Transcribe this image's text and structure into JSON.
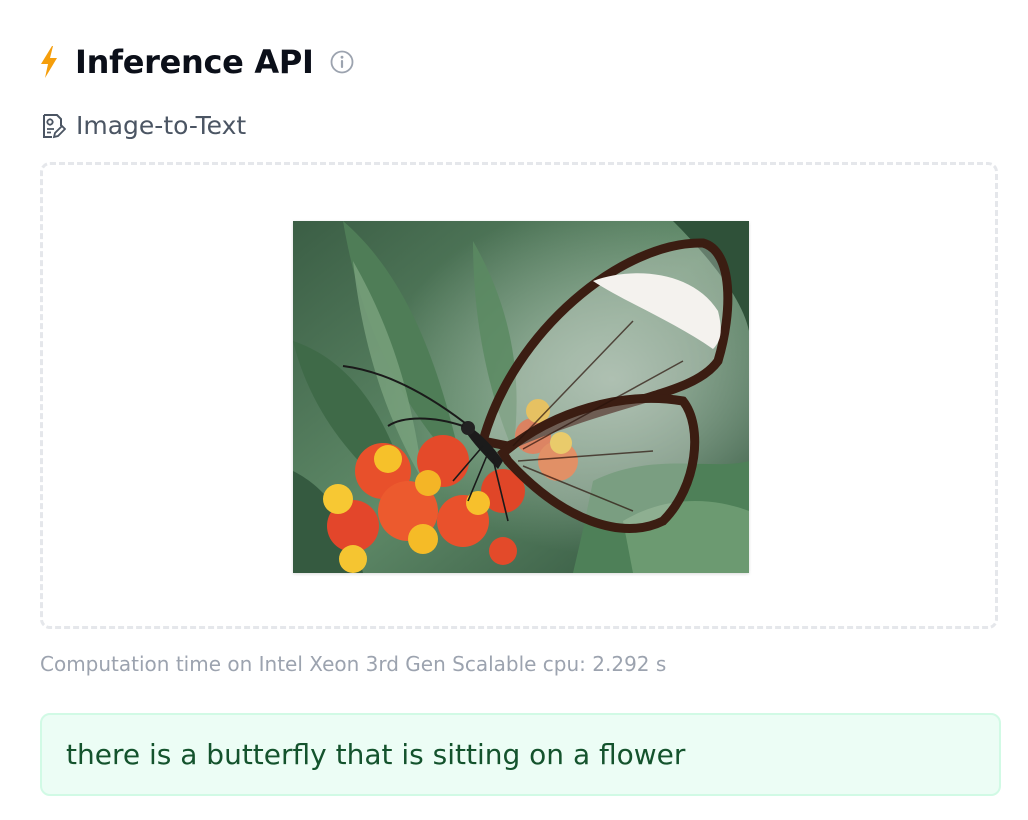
{
  "header": {
    "title": "Inference API",
    "bolt_icon": "lightning-bolt-icon",
    "info_icon": "info-icon",
    "accent_color": "#f59e0b"
  },
  "task": {
    "icon": "image-to-text-task-icon",
    "label": "Image-to-Text"
  },
  "dropzone": {
    "image_subject": "butterfly on orange and yellow flowers"
  },
  "computation": {
    "text": "Computation time on Intel Xeon 3rd Gen Scalable cpu: 2.292 s"
  },
  "result": {
    "text": "there is a butterfly that is sitting on a flower",
    "background_color": "#ecfdf5",
    "text_color": "#14532d"
  }
}
